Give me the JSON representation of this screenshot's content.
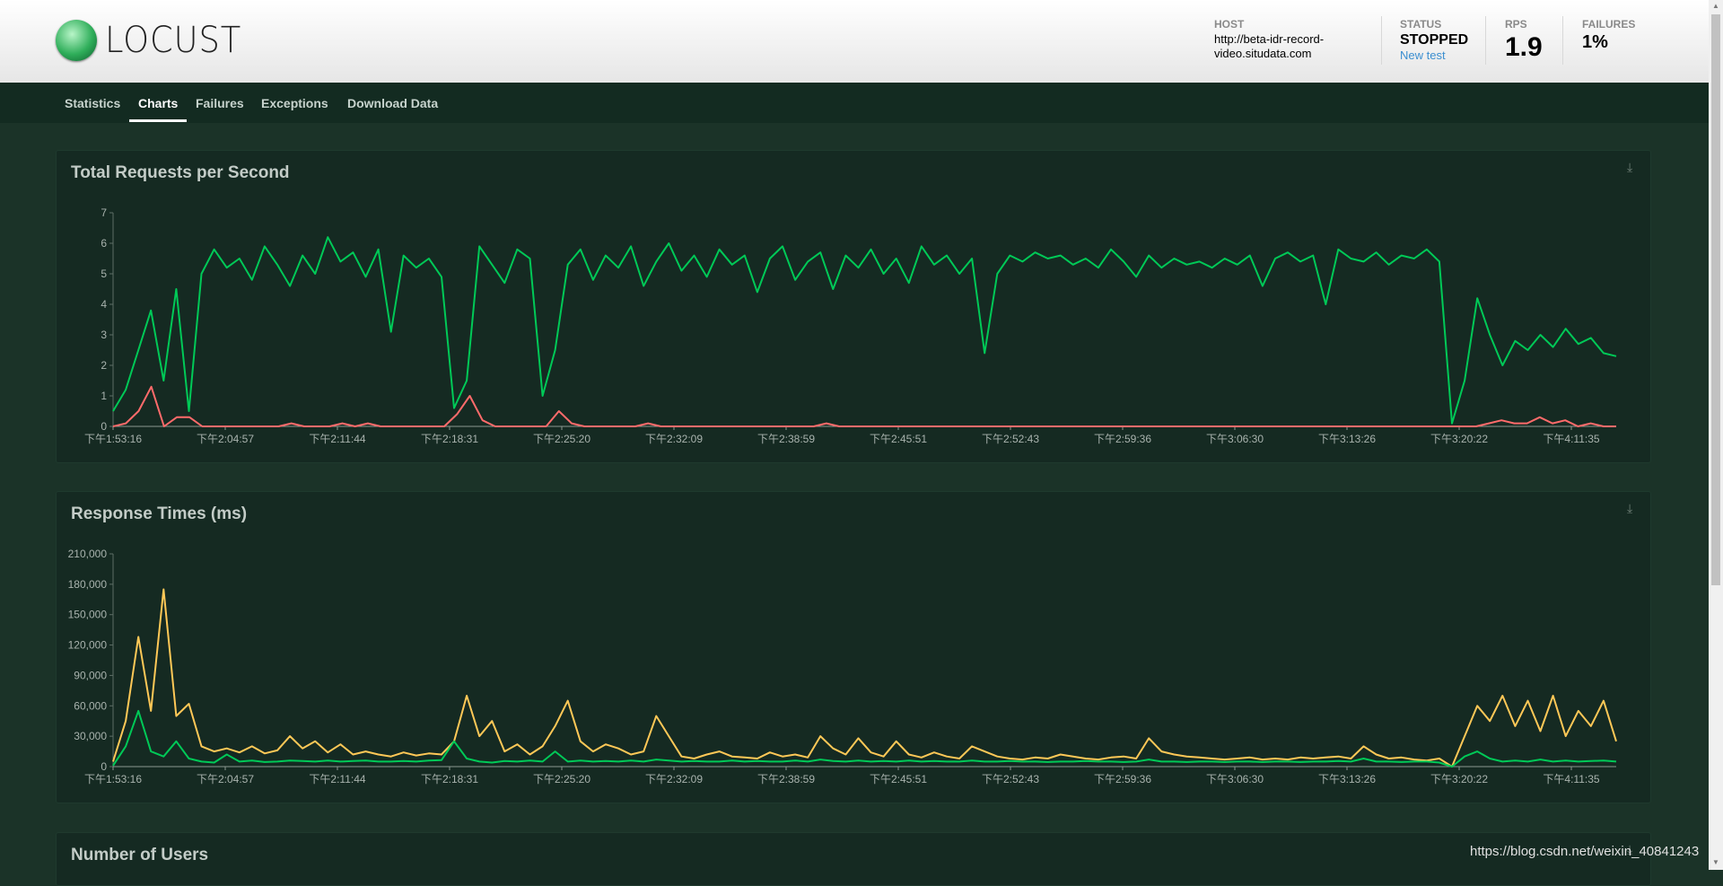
{
  "app": {
    "logo_text": "LOCUST"
  },
  "header": {
    "host_label": "HOST",
    "host_line1": "http://beta-idr-record-",
    "host_line2": "video.situdata.com",
    "status_label": "STATUS",
    "status_value": "STOPPED",
    "new_test": "New test",
    "rps_label": "RPS",
    "rps_value": "1.9",
    "failures_label": "FAILURES",
    "failures_value": "1%"
  },
  "nav": {
    "tabs": [
      {
        "label": "Statistics"
      },
      {
        "label": "Charts",
        "active": true
      },
      {
        "label": "Failures"
      },
      {
        "label": "Exceptions"
      },
      {
        "label": "Download Data"
      }
    ]
  },
  "panels": {
    "p1_title": "Total Requests per Second",
    "p2_title": "Response Times (ms)",
    "p3_title": "Number of Users"
  },
  "watermark": "https://blog.csdn.net/weixin_40841243",
  "colors": {
    "green": "#00c957",
    "red": "#ff6b6b",
    "yellow": "#ffc857",
    "panel": "#152a22",
    "background": "#1b3328"
  },
  "icons": {
    "download": "download-icon"
  },
  "chart_data": [
    {
      "type": "line",
      "title": "Total Requests per Second",
      "x_ticks": [
        "下午1:53:16",
        "下午2:04:57",
        "下午2:11:44",
        "下午2:18:31",
        "下午2:25:20",
        "下午2:32:09",
        "下午2:38:59",
        "下午2:45:51",
        "下午2:52:43",
        "下午2:59:36",
        "下午3:06:30",
        "下午3:13:26",
        "下午3:20:22",
        "下午4:11:35"
      ],
      "ylim": [
        0,
        7
      ],
      "y_ticks": [
        0,
        1,
        2,
        3,
        4,
        5,
        6,
        7
      ],
      "series": [
        {
          "color": "#00c957",
          "values": [
            0.5,
            1.2,
            2.5,
            3.8,
            1.5,
            4.5,
            0.5,
            5.0,
            5.8,
            5.2,
            5.5,
            4.8,
            5.9,
            5.3,
            4.6,
            5.6,
            5.0,
            6.2,
            5.4,
            5.7,
            4.9,
            5.8,
            3.1,
            5.6,
            5.2,
            5.5,
            4.9,
            0.6,
            1.5,
            5.9,
            5.3,
            4.7,
            5.8,
            5.5,
            1.0,
            2.5,
            5.3,
            5.8,
            4.8,
            5.6,
            5.2,
            5.9,
            4.6,
            5.4,
            6.0,
            5.1,
            5.6,
            4.9,
            5.8,
            5.3,
            5.6,
            4.4,
            5.5,
            5.9,
            4.8,
            5.4,
            5.7,
            4.5,
            5.6,
            5.2,
            5.8,
            5.0,
            5.5,
            4.7,
            5.9,
            5.3,
            5.6,
            5.0,
            5.5,
            2.4,
            5.0,
            5.6,
            5.4,
            5.7,
            5.5,
            5.6,
            5.3,
            5.5,
            5.2,
            5.8,
            5.4,
            4.9,
            5.6,
            5.2,
            5.5,
            5.3,
            5.4,
            5.2,
            5.5,
            5.3,
            5.6,
            4.6,
            5.5,
            5.7,
            5.4,
            5.6,
            4.0,
            5.8,
            5.5,
            5.4,
            5.7,
            5.3,
            5.6,
            5.5,
            5.8,
            5.4,
            0.1,
            1.5,
            4.2,
            3.0,
            2.0,
            2.8,
            2.5,
            3.0,
            2.6,
            3.2,
            2.7,
            2.9,
            2.4,
            2.3
          ]
        },
        {
          "color": "#ff6b6b",
          "values": [
            0,
            0.1,
            0.5,
            1.3,
            0,
            0.3,
            0.3,
            0,
            0,
            0,
            0,
            0,
            0,
            0,
            0.1,
            0,
            0,
            0,
            0.1,
            0,
            0.1,
            0,
            0,
            0,
            0,
            0,
            0,
            0.4,
            1.0,
            0.2,
            0,
            0,
            0,
            0,
            0,
            0.5,
            0.1,
            0,
            0,
            0,
            0,
            0,
            0.1,
            0,
            0,
            0,
            0,
            0,
            0,
            0,
            0,
            0,
            0,
            0,
            0,
            0,
            0.1,
            0,
            0,
            0,
            0,
            0,
            0,
            0,
            0,
            0,
            0,
            0,
            0,
            0,
            0,
            0,
            0,
            0,
            0,
            0,
            0,
            0,
            0,
            0,
            0,
            0,
            0,
            0,
            0,
            0,
            0,
            0,
            0,
            0,
            0,
            0,
            0,
            0,
            0,
            0,
            0,
            0,
            0,
            0,
            0,
            0,
            0,
            0,
            0,
            0,
            0,
            0,
            0.1,
            0.2,
            0.1,
            0.1,
            0.3,
            0.1,
            0.2,
            0,
            0.1,
            0,
            0
          ]
        }
      ]
    },
    {
      "type": "line",
      "title": "Response Times (ms)",
      "x_ticks": [
        "下午1:53:16",
        "下午2:04:57",
        "下午2:11:44",
        "下午2:18:31",
        "下午2:25:20",
        "下午2:32:09",
        "下午2:38:59",
        "下午2:45:51",
        "下午2:52:43",
        "下午2:59:36",
        "下午3:06:30",
        "下午3:13:26",
        "下午3:20:22",
        "下午4:11:35"
      ],
      "ylim": [
        0,
        210000
      ],
      "y_ticks": [
        "0",
        "30,000",
        "60,000",
        "90,000",
        "120,000",
        "150,000",
        "180,000",
        "210,000"
      ],
      "series": [
        {
          "color": "#ffc857",
          "values": [
            5000,
            45000,
            128000,
            55000,
            175000,
            50000,
            62000,
            20000,
            15000,
            18000,
            14000,
            20000,
            13000,
            16000,
            30000,
            18000,
            25000,
            14000,
            22000,
            12000,
            15000,
            12000,
            10000,
            14000,
            11000,
            13000,
            12000,
            25000,
            70000,
            30000,
            45000,
            15000,
            22000,
            12000,
            20000,
            40000,
            65000,
            25000,
            15000,
            22000,
            18000,
            12000,
            15000,
            50000,
            30000,
            10000,
            8000,
            12000,
            15000,
            10000,
            9000,
            8000,
            14000,
            10000,
            12000,
            9000,
            30000,
            18000,
            12000,
            28000,
            14000,
            10000,
            25000,
            12000,
            9000,
            14000,
            10000,
            8000,
            20000,
            15000,
            10000,
            8000,
            7000,
            9000,
            8000,
            12000,
            10000,
            8000,
            7000,
            9000,
            10000,
            8000,
            28000,
            15000,
            12000,
            10000,
            9000,
            8000,
            7000,
            8000,
            9000,
            7000,
            8000,
            7000,
            9000,
            8000,
            9000,
            10000,
            8000,
            20000,
            12000,
            8000,
            9000,
            7000,
            6000,
            8000,
            0,
            30000,
            60000,
            45000,
            70000,
            40000,
            65000,
            35000,
            70000,
            30000,
            55000,
            40000,
            65000,
            25000
          ]
        },
        {
          "color": "#00c957",
          "values": [
            1000,
            20000,
            55000,
            15000,
            10000,
            25000,
            8000,
            5000,
            4000,
            12000,
            5000,
            6000,
            4500,
            5000,
            6000,
            5500,
            5000,
            6000,
            5000,
            5500,
            6000,
            5000,
            5000,
            5500,
            5000,
            6000,
            6500,
            25000,
            8000,
            5000,
            4000,
            5500,
            5000,
            6000,
            5000,
            15000,
            5000,
            6000,
            5000,
            5500,
            5000,
            6000,
            5000,
            7000,
            6000,
            5000,
            5500,
            5000,
            5000,
            6000,
            5000,
            5500,
            5000,
            5000,
            6000,
            5000,
            7000,
            5500,
            5000,
            6000,
            5000,
            5500,
            5000,
            6000,
            5000,
            5500,
            5000,
            5000,
            6000,
            5000,
            5000,
            5500,
            5000,
            5000,
            4500,
            5000,
            5000,
            5500,
            5000,
            5000,
            4500,
            5000,
            7000,
            5000,
            5000,
            4500,
            5000,
            5000,
            4500,
            5000,
            5000,
            4500,
            5000,
            5000,
            4500,
            5000,
            5000,
            5500,
            5000,
            8000,
            5000,
            5000,
            4500,
            5000,
            5000,
            4000,
            0,
            10000,
            15000,
            8000,
            5000,
            6000,
            5000,
            7000,
            5000,
            6000,
            5000,
            5500,
            6000,
            5000
          ]
        }
      ]
    }
  ]
}
